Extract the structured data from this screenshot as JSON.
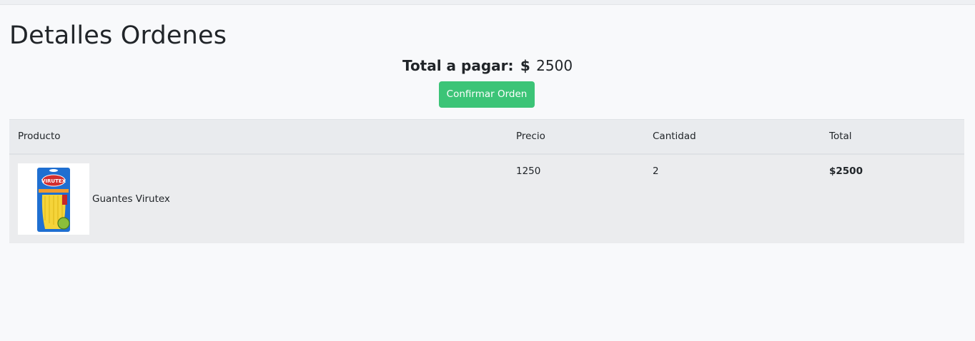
{
  "page": {
    "title": "Detalles Ordenes"
  },
  "summary": {
    "total_label": "Total a pagar:",
    "currency": "$",
    "total_value": "2500",
    "confirm_label": "Confirmar Orden"
  },
  "table": {
    "headers": [
      "Producto",
      "Precio",
      "Cantidad",
      "Total"
    ],
    "rows": [
      {
        "product": "Guantes Virutex",
        "product_image_text": "VIRUTEX",
        "price": "1250",
        "quantity": "2",
        "total": "$2500"
      }
    ]
  },
  "colors": {
    "accent": "#3cc477",
    "background": "#f8f9fb",
    "table_header": "#e9ebee",
    "table_row": "#ebecee"
  }
}
